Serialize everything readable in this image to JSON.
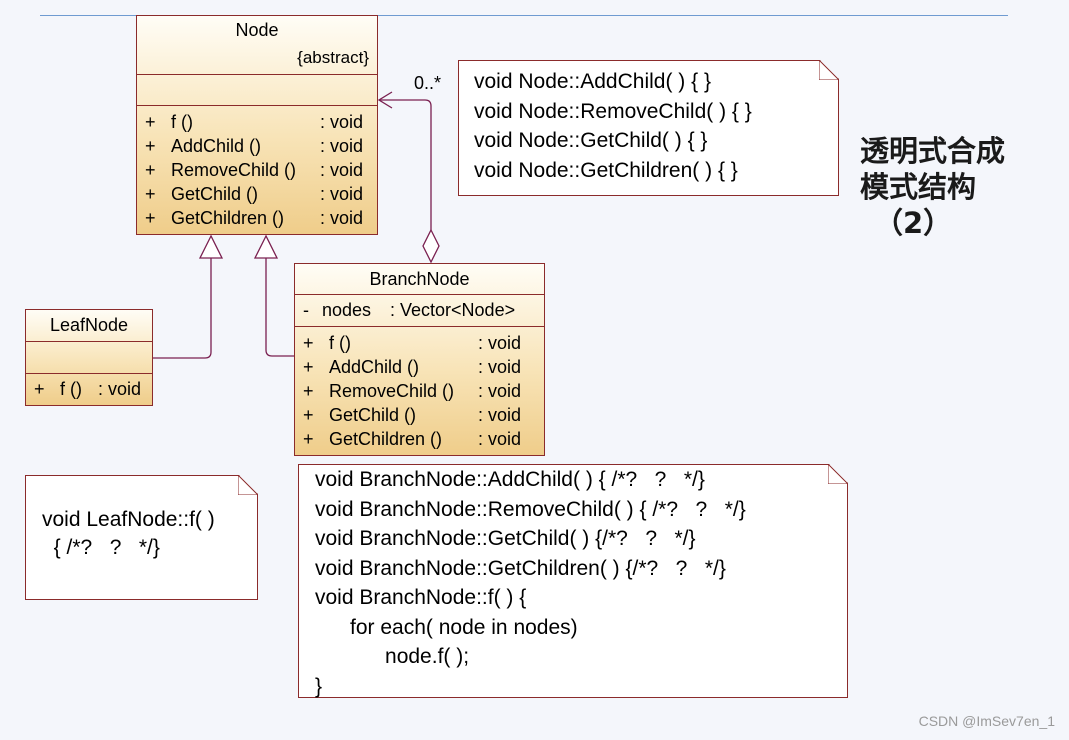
{
  "node": {
    "name": "Node",
    "stereotype": "{abstract}",
    "methods": [
      {
        "vis": "+",
        "name": "f ()",
        "type": ": void"
      },
      {
        "vis": "+",
        "name": "AddChild ()",
        "type": ": void"
      },
      {
        "vis": "+",
        "name": "RemoveChild ()",
        "type": ": void"
      },
      {
        "vis": "+",
        "name": "GetChild ()",
        "type": ": void"
      },
      {
        "vis": "+",
        "name": "GetChildren ()",
        "type": ": void"
      }
    ]
  },
  "leaf": {
    "name": "LeafNode",
    "method": {
      "vis": "+",
      "name": "f ()",
      "type": ": void"
    }
  },
  "branch": {
    "name": "BranchNode",
    "attribute": {
      "vis": "-",
      "name": "nodes",
      "type": ": Vector<Node>"
    },
    "methods": [
      {
        "vis": "+",
        "name": "f ()",
        "type": ": void"
      },
      {
        "vis": "+",
        "name": "AddChild ()",
        "type": ": void"
      },
      {
        "vis": "+",
        "name": "RemoveChild ()",
        "type": ": void"
      },
      {
        "vis": "+",
        "name": "GetChild ()",
        "type": ": void"
      },
      {
        "vis": "+",
        "name": "GetChildren ()",
        "type": ": void"
      }
    ]
  },
  "multiplicity": "0..*",
  "note_node": [
    "void Node::AddChild( ) { }",
    "void Node::RemoveChild( ) { }",
    "void Node::GetChild( ) { }",
    "void Node::GetChildren( ) { }"
  ],
  "note_leaf": [
    "void LeafNode::f( )",
    "  { /*?   ?   */}"
  ],
  "note_branch": [
    "void BranchNode::AddChild( ) { /*?   ?   */}",
    "void BranchNode::RemoveChild( ) { /*?   ?   */}",
    "void BranchNode::GetChild( ) {/*?   ?   */}",
    "void BranchNode::GetChildren( ) {/*?   ?   */}",
    "void BranchNode::f( ) {",
    "      for each( node in nodes)",
    "            node.f( );",
    "}"
  ],
  "heading": {
    "line1": "透明式合成",
    "line2": "模式结构",
    "line3": "（2）"
  },
  "watermark": "CSDN @ImSev7en_1",
  "colors": {
    "border": "#8b2b2b",
    "fill_top": "#fffdf6",
    "fill_bottom": "#efcd8a",
    "topline": "#6f9bd1"
  }
}
